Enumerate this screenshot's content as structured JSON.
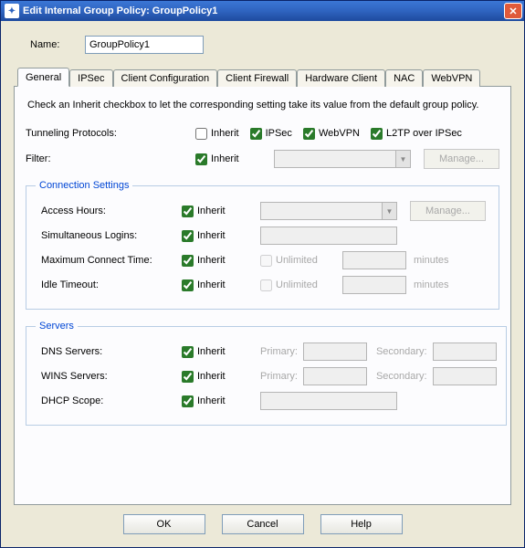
{
  "window": {
    "title": "Edit Internal Group Policy: GroupPolicy1"
  },
  "form": {
    "name_label": "Name:",
    "name_value": "GroupPolicy1"
  },
  "tabs": {
    "general": "General",
    "ipsec": "IPSec",
    "clientconfig": "Client Configuration",
    "clientfirewall": "Client Firewall",
    "hardwareclient": "Hardware Client",
    "nac": "NAC",
    "webvpn": "WebVPN"
  },
  "general": {
    "info": "Check an Inherit checkbox to let the corresponding setting take its value from the default group policy.",
    "tunneling_label": "Tunneling Protocols:",
    "filter_label": "Filter:",
    "inherit": "Inherit",
    "ipsec": "IPSec",
    "webvpn": "WebVPN",
    "l2tp": "L2TP over IPSec",
    "manage": "Manage..."
  },
  "conn": {
    "legend": "Connection Settings",
    "access_hours": "Access Hours:",
    "simul_logins": "Simultaneous Logins:",
    "max_connect": "Maximum Connect Time:",
    "idle_timeout": "Idle Timeout:",
    "unlimited": "Unlimited",
    "minutes": "minutes",
    "manage": "Manage..."
  },
  "servers": {
    "legend": "Servers",
    "dns": "DNS Servers:",
    "wins": "WINS Servers:",
    "dhcp": "DHCP Scope:",
    "primary": "Primary:",
    "secondary": "Secondary:"
  },
  "buttons": {
    "ok": "OK",
    "cancel": "Cancel",
    "help": "Help"
  }
}
